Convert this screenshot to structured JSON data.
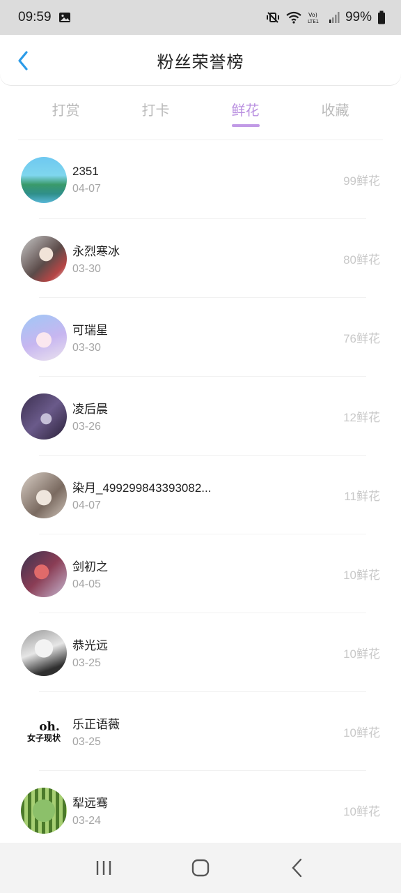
{
  "status_bar": {
    "time": "09:59",
    "battery": "99%",
    "icons": [
      "gallery-icon",
      "mute-vibrate-icon",
      "wifi-icon",
      "volte-icon",
      "signal-icon",
      "battery-icon"
    ]
  },
  "header": {
    "title": "粉丝荣誉榜",
    "back_icon": "chevron-left-icon"
  },
  "tabs": [
    {
      "label": "打赏",
      "active": false
    },
    {
      "label": "打卡",
      "active": false
    },
    {
      "label": "鲜花",
      "active": true
    },
    {
      "label": "收藏",
      "active": false
    }
  ],
  "list": [
    {
      "name": "2351",
      "date": "04-07",
      "count": "99鲜花"
    },
    {
      "name": "永烈寒冰",
      "date": "03-30",
      "count": "80鲜花"
    },
    {
      "name": "可瑞星",
      "date": "03-30",
      "count": "76鲜花"
    },
    {
      "name": "凌后晨",
      "date": "03-26",
      "count": "12鲜花"
    },
    {
      "name": "染月_499299843393082...",
      "date": "04-07",
      "count": "11鲜花"
    },
    {
      "name": "剑初之",
      "date": "04-05",
      "count": "10鲜花"
    },
    {
      "name": "恭光远",
      "date": "03-25",
      "count": "10鲜花"
    },
    {
      "name": "乐正语薇",
      "date": "03-25",
      "count": "10鲜花",
      "avatar_text": [
        "oh.",
        "女子现状"
      ]
    },
    {
      "name": "犁远骞",
      "date": "03-24",
      "count": "10鲜花"
    }
  ],
  "nav_bar": {
    "icons": [
      "recent-apps-icon",
      "home-icon",
      "back-icon"
    ]
  },
  "colors": {
    "accent": "#b98fe0",
    "back_arrow": "#2b9be8"
  }
}
